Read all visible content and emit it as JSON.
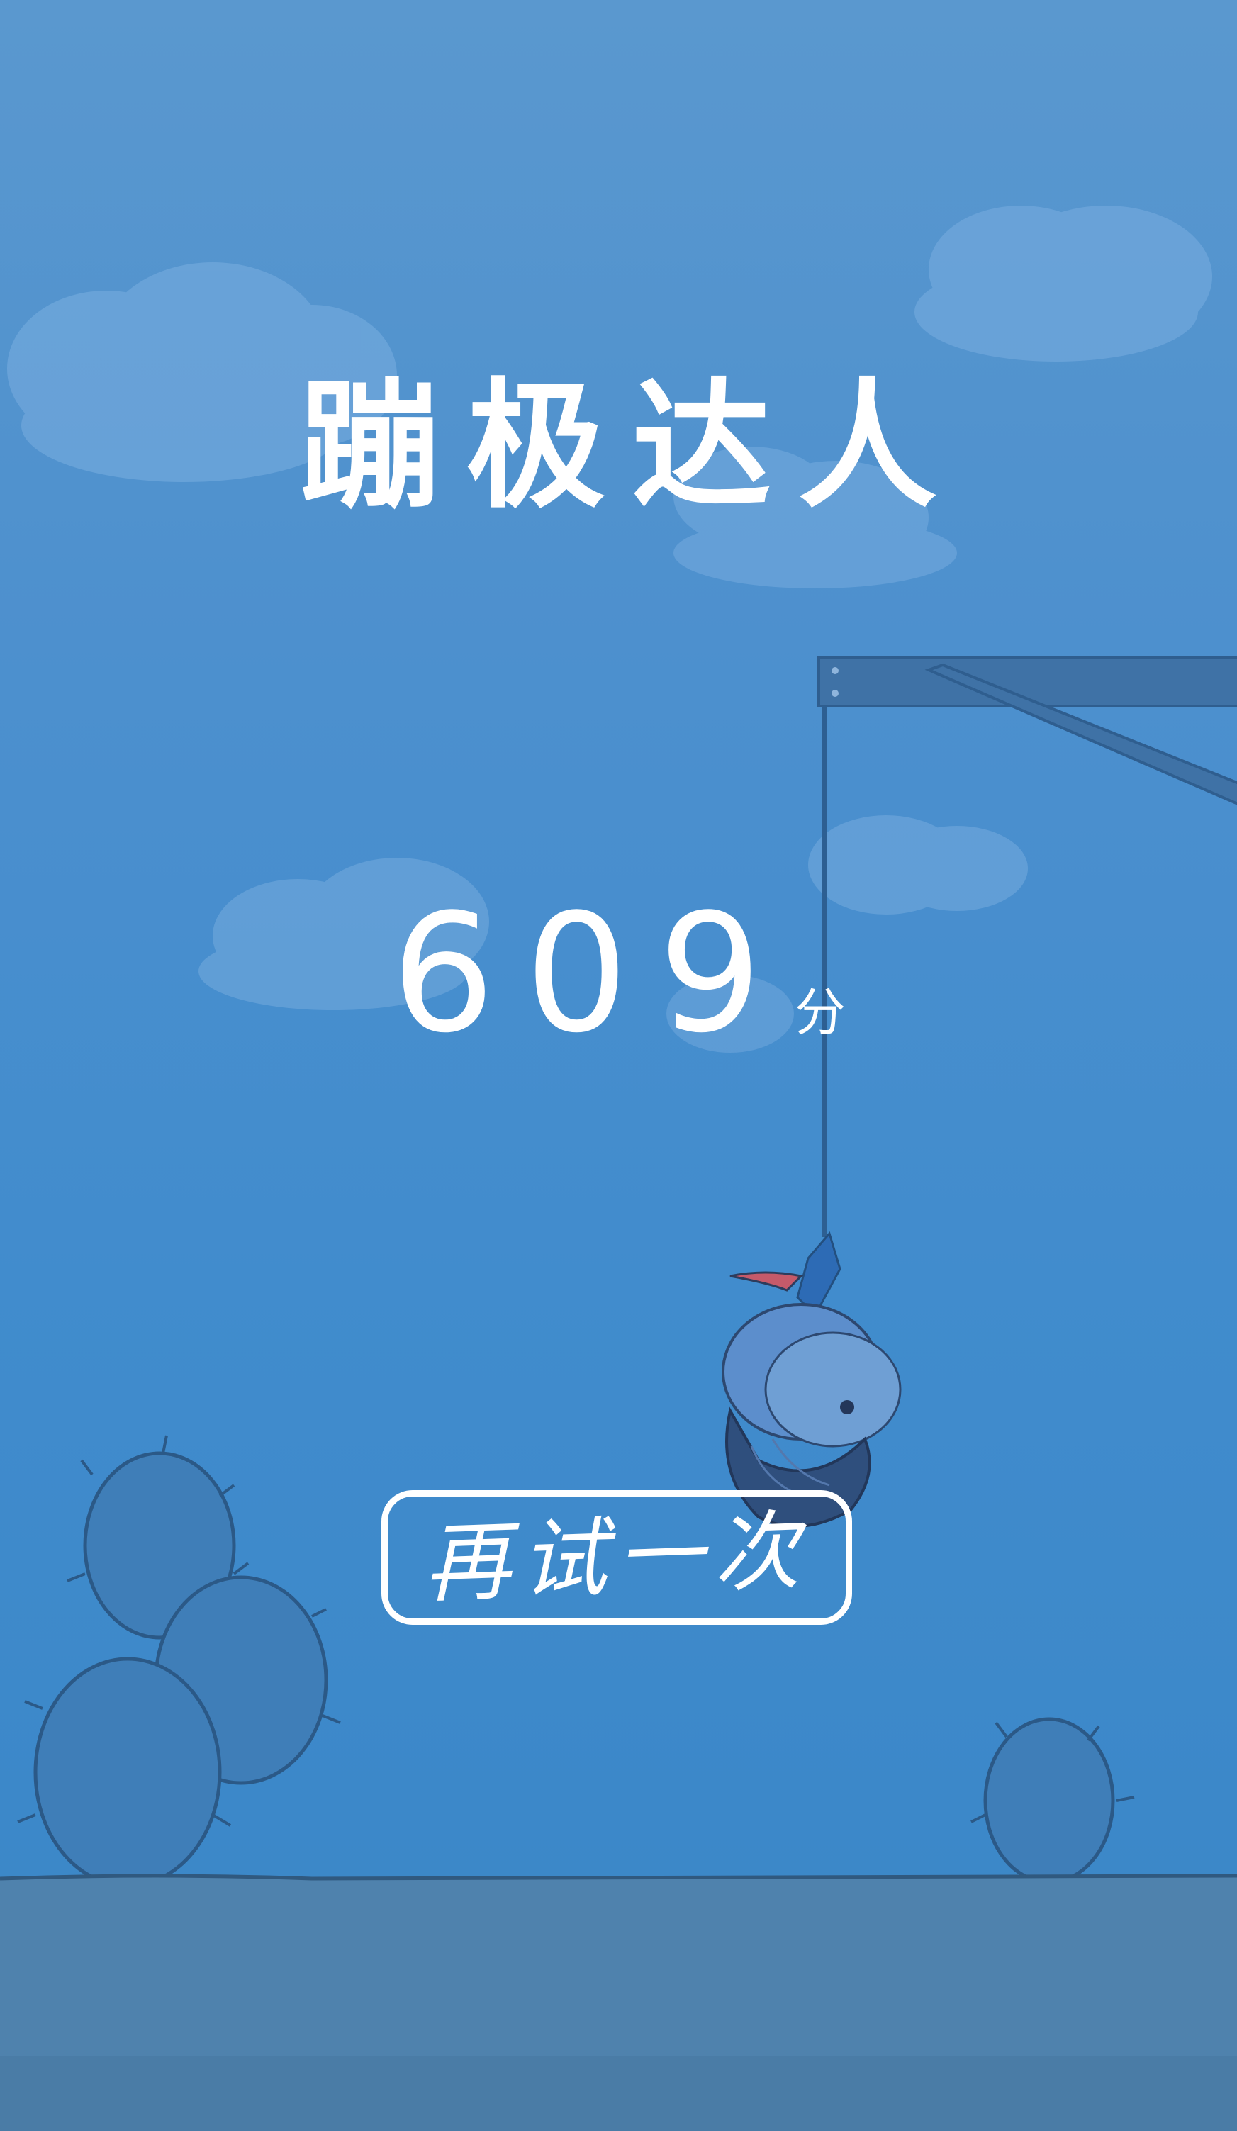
{
  "game": {
    "title": "蹦极达人",
    "score": {
      "value": "609",
      "unit": "分"
    },
    "retry_button": {
      "label": "再试一次"
    }
  },
  "colors": {
    "sky_top": "#5a98cf",
    "sky_bottom": "#3c88c9",
    "ground": "#4f82ad",
    "cactus": "#3f7eb8",
    "text": "#ffffff"
  },
  "icons": [
    "cloud",
    "cactus",
    "gallows-platform",
    "bungee-rope",
    "bungee-character"
  ]
}
